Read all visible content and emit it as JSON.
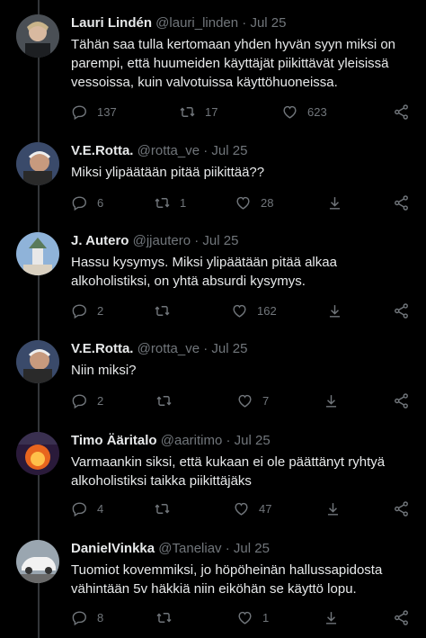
{
  "tweets": [
    {
      "name": "Lauri Lindén",
      "handle": "@lauri_linden",
      "date": "Jul 25",
      "text": "Tähän saa tulla kertomaan yhden hyvän syyn miksi on parempi, että huumeiden käyttäjät piikittävät yleisissä vessoissa, kuin valvotuissa käyttöhuoneissa.",
      "replies": "137",
      "retweets": "17",
      "likes": "623"
    },
    {
      "name": "V.E.Rotta.",
      "handle": "@rotta_ve",
      "date": "Jul 25",
      "text": "Miksi ylipäätään pitää piikittää??",
      "replies": "6",
      "retweets": "1",
      "likes": "28"
    },
    {
      "name": "J. Autero",
      "handle": "@jjautero",
      "date": "Jul 25",
      "text": "Hassu kysymys. Miksi ylipäätään pitää alkaa alkoholistiksi, on yhtä absurdi kysymys.",
      "replies": "2",
      "retweets": "",
      "likes": "162"
    },
    {
      "name": "V.E.Rotta.",
      "handle": "@rotta_ve",
      "date": "Jul 25",
      "text": "Niin miksi?",
      "replies": "2",
      "retweets": "",
      "likes": "7"
    },
    {
      "name": "Timo Ääritalo",
      "handle": "@aaritimo",
      "date": "Jul 25",
      "text": "Varmaankin siksi, että kukaan ei ole päättänyt ryhtyä alkoholistiksi taikka piikittäjäks",
      "replies": "4",
      "retweets": "",
      "likes": "47"
    },
    {
      "name": "DanielVinkka",
      "handle": "@Taneliav",
      "date": "Jul 25",
      "text": "Tuomiot kovemmiksi, jo höpöheinän hallussapidosta vähintään 5v häkkiä niin eiköhän se käyttö lopu.",
      "replies": "8",
      "retweets": "",
      "likes": "1"
    }
  ],
  "separator": "·",
  "icons": [
    "reply-icon",
    "retweet-icon",
    "like-icon",
    "view-icon",
    "share-icon"
  ],
  "colors": {
    "background": "#000000",
    "text": "#e7e9ea",
    "muted": "#71767b",
    "line": "#333639"
  }
}
